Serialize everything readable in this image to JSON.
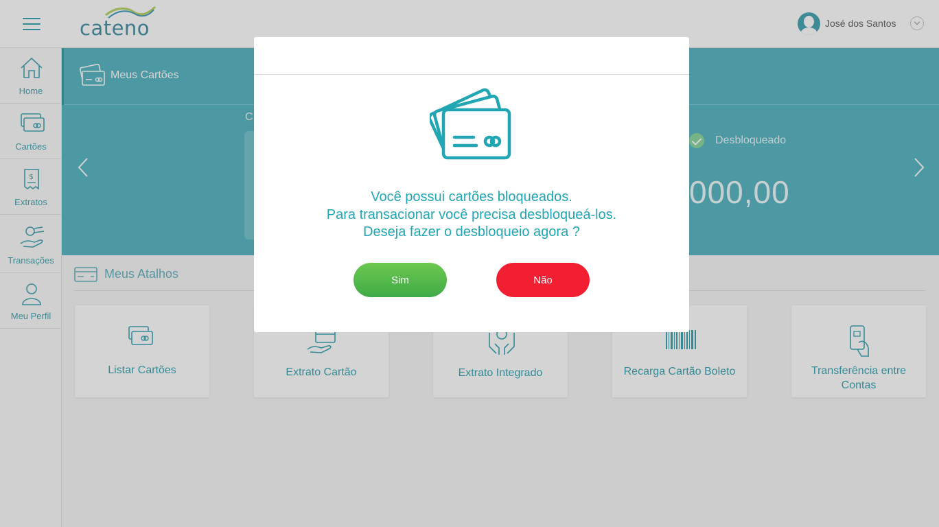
{
  "header": {
    "logo_text": "cateno",
    "user_name": "José dos Santos"
  },
  "sidenav": {
    "items": [
      {
        "label": "Home",
        "icon": "home-icon"
      },
      {
        "label": "Cartões",
        "icon": "cards-icon"
      },
      {
        "label": "Extratos",
        "icon": "statement-icon"
      },
      {
        "label": "Transações",
        "icon": "transactions-icon"
      },
      {
        "label": "Meu Perfil",
        "icon": "profile-icon"
      }
    ]
  },
  "banner": {
    "title": "Meus Cartões",
    "card_label_fragment": "C",
    "status": "Desbloqueado",
    "balance": "000,00"
  },
  "shortcuts": {
    "title": "Meus Atalhos",
    "tiles": [
      {
        "label": "Listar Cartões",
        "icon": "cards-icon"
      },
      {
        "label": "Extrato Cartão",
        "icon": "hand-card-icon"
      },
      {
        "label": "Extrato Integrado",
        "icon": "hands-money-icon"
      },
      {
        "label": "Recarga Cartão Boleto",
        "icon": "barcode-icon"
      },
      {
        "label": "Transferência entre Contas",
        "icon": "transfer-icon"
      }
    ]
  },
  "modal": {
    "line1": "Você possui cartões bloqueados.",
    "line2": "Para transacionar você precisa desbloqueá-los.",
    "line3": "Deseja fazer o desbloqueio agora ?",
    "yes_label": "Sim",
    "no_label": "Não"
  },
  "colors": {
    "accent": "#22a6b4",
    "banner": "#5cb8c6",
    "yes_button": "#4cb94a",
    "no_button": "#f21f33"
  }
}
